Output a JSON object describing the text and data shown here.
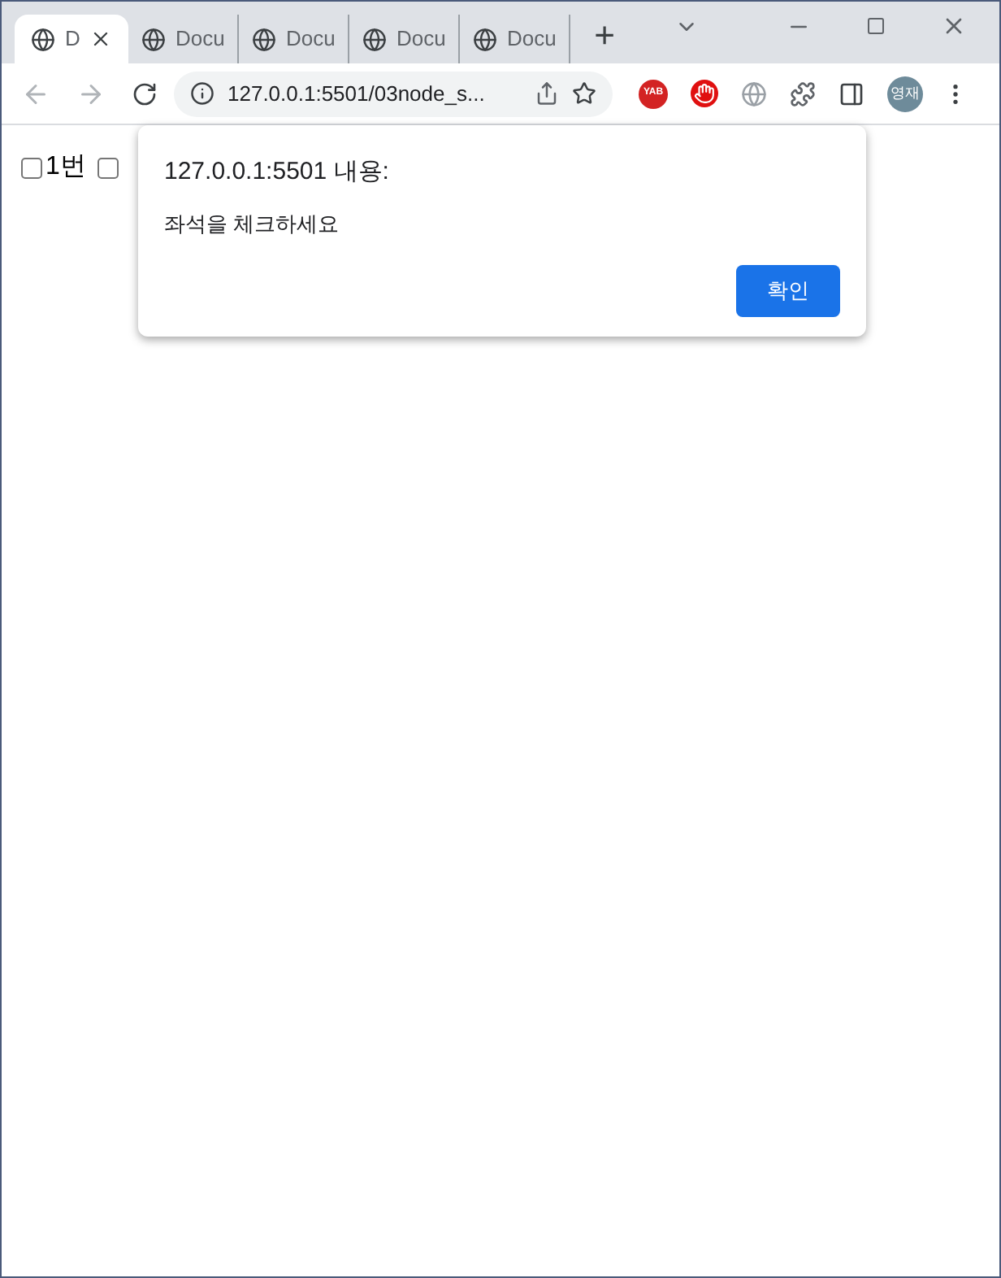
{
  "tabs": [
    {
      "title": "D",
      "selected": true
    },
    {
      "title": "Docu",
      "selected": false
    },
    {
      "title": "Docu",
      "selected": false
    },
    {
      "title": "Docu",
      "selected": false
    },
    {
      "title": "Docu",
      "selected": false
    }
  ],
  "new_tab": "+",
  "address": "127.0.0.1:5501/03node_s...",
  "extension_badge": "YAB",
  "profile": "영재",
  "checkboxes": [
    {
      "label": "1번",
      "checked": false
    },
    {
      "checked": false
    }
  ],
  "dialog": {
    "title": "127.0.0.1:5501 내용:",
    "message": "좌석을 체크하세요",
    "button": "확인"
  }
}
